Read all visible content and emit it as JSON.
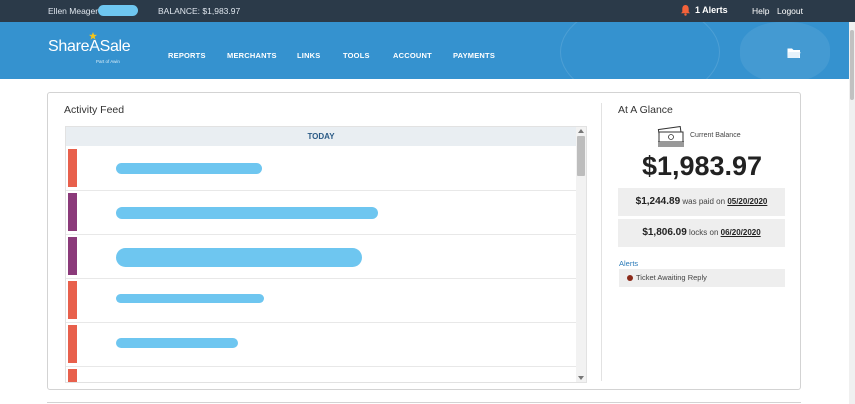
{
  "topbar": {
    "user_name": "Ellen Meager",
    "balance_text": "BALANCE: $1,983.97",
    "alerts_label": "1 Alerts",
    "help": "Help",
    "logout": "Logout"
  },
  "header": {
    "logo": "ShareASale",
    "logo_sub": "Part of Awin",
    "nav": [
      "REPORTS",
      "MERCHANTS",
      "LINKS",
      "TOOLS",
      "ACCOUNT",
      "PAYMENTS"
    ]
  },
  "feed": {
    "title": "Activity Feed",
    "section_label": "TODAY",
    "rows": [
      {
        "color": "#e8604c"
      },
      {
        "color": "#8b3a7a"
      },
      {
        "color": "#8b3a7a"
      },
      {
        "color": "#e8604c"
      },
      {
        "color": "#e8604c"
      },
      {
        "color": "#e8604c"
      }
    ]
  },
  "glance": {
    "title": "At A Glance",
    "current_balance_label": "Current Balance",
    "balance": "$1,983.97",
    "paid_amount": "$1,244.89",
    "paid_text": "was paid on",
    "paid_date": "05/20/2020",
    "locks_amount": "$1,806.09",
    "locks_text": "locks on",
    "locks_date": "06/20/2020",
    "alerts_label": "Alerts",
    "alert_item": "Ticket Awaiting Reply"
  },
  "colors": {
    "topbar": "#2b3a49",
    "header": "#3592cf",
    "redaction": "#6ec6f0"
  }
}
